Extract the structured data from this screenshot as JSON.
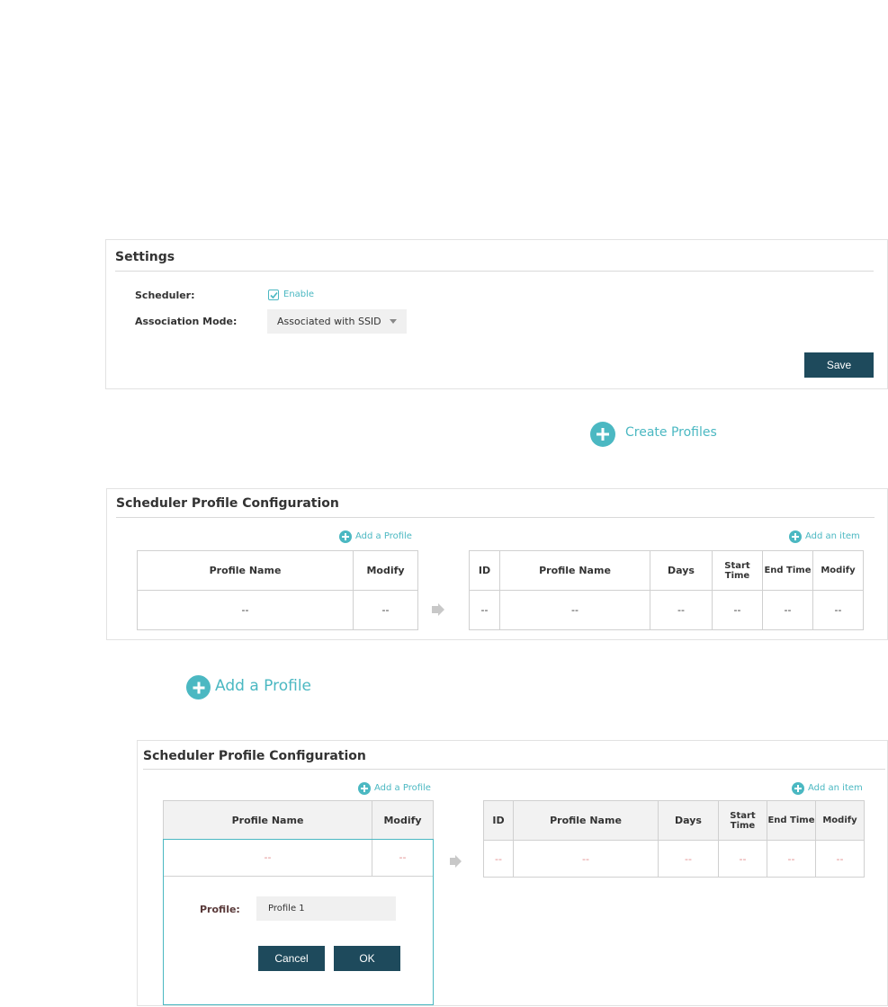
{
  "settings": {
    "title": "Settings",
    "scheduler_label": "Scheduler:",
    "scheduler_enable_label": "Enable",
    "scheduler_checked": true,
    "association_label": "Association Mode:",
    "association_value": "Associated with SSID",
    "save_label": "Save"
  },
  "callout_create": "Create Profiles",
  "config1": {
    "title": "Scheduler Profile Configuration",
    "add_profile": "Add a Profile",
    "add_item": "Add an item",
    "profile_headers": [
      "Profile Name",
      "Modify"
    ],
    "profile_row": [
      "--",
      "--"
    ],
    "item_headers": [
      "ID",
      "Profile Name",
      "Days",
      "Start Time",
      "End Time",
      "Modify"
    ],
    "item_row": [
      "--",
      "--",
      "--",
      "--",
      "--",
      "--"
    ]
  },
  "callout_add": "Add a Profile",
  "config2": {
    "title": "Scheduler Profile Configuration",
    "add_profile": "Add a Profile",
    "add_item": "Add an item",
    "profile_headers": [
      "Profile Name",
      "Modify"
    ],
    "profile_row": [
      "--",
      "--"
    ],
    "item_headers": [
      "ID",
      "Profile Name",
      "Days",
      "Start Time",
      "End Time",
      "Modify"
    ],
    "item_row": [
      "--",
      "--",
      "--",
      "--",
      "--",
      "--"
    ],
    "profile_field_label": "Profile:",
    "profile_field_value": "Profile 1",
    "cancel_label": "Cancel",
    "ok_label": "OK"
  },
  "colors": {
    "accent": "#4bb8c2",
    "button": "#1e4a5c"
  }
}
